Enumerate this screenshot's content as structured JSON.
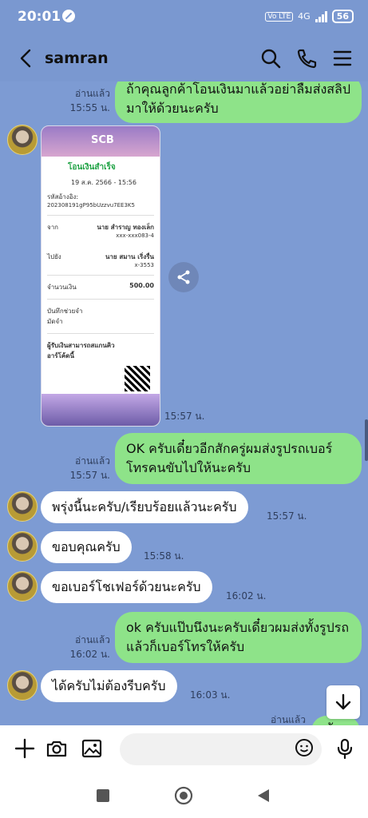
{
  "status": {
    "time": "20:01",
    "volte": "Vo LTE",
    "network": "4G",
    "battery": "56"
  },
  "header": {
    "title": "samran"
  },
  "messages": {
    "m0": {
      "text": "ถ้าคุณลูกค้าโอนเงินมาแล้วอย่าลืมส่งสลิปมาให้ด้วยนะครับ",
      "read": "อ่านแล้ว",
      "time": "15:55 น."
    },
    "slip": {
      "bank": "SCB",
      "status": "โอนเงินสำเร็จ",
      "date": "19 ส.ค. 2566 - 15:56",
      "ref_label": "รหัสอ้างอิง:",
      "ref": "202308191gP95bUzzvu7EE3K5",
      "from_label": "จาก",
      "from_name": "นาย สำราญ ทองเล็ก",
      "from_acct": "xxx-xxx083-4",
      "to_label": "ไปยัง",
      "to_name": "นาย สมาน เริ่งรื่น",
      "to_acct": "x-3553",
      "amount_label": "จำนวนเงิน",
      "amount": "500.00",
      "memo_label": "บันทึกช่วยจำ",
      "memo": "มัดจำ",
      "qr_label": "ผู้รับเงินสามารถสแกนคิวอาร์โค้ดนี้",
      "time": "15:57 น."
    },
    "m1": {
      "text": "OK ครับเดี๋ยวอีกสักครู่ผมส่งรูปรถเบอร์โทรคนขับไปให้นะครับ",
      "read": "อ่านแล้ว",
      "time": "15:57 น."
    },
    "m2": {
      "text": "พรุ่งนี้นะครับ/เรียบร้อยแล้วนะครับ",
      "time": "15:57 น."
    },
    "m3": {
      "text": "ขอบคุณครับ",
      "time": "15:58 น."
    },
    "m4": {
      "text": "ขอเบอร์โชเฟอร์ด้วยนะครับ",
      "time": "16:02 น."
    },
    "m5": {
      "text": "ok ครับแป๊บนึงนะครับเดี๋ยวผมส่งทั้งรูปรถแล้วก็เบอร์โทรให้ครับ",
      "read": "อ่านแล้ว",
      "time": "16:02 น."
    },
    "m6": {
      "text": "ได้ครับไม่ต้องรีบครับ",
      "time": "16:03 น."
    },
    "m7": {
      "text": "ครับ",
      "read": "อ่านแล้ว"
    }
  },
  "input": {
    "placeholder": ""
  },
  "colors": {
    "chat_bg": "#7d9bd3",
    "outgoing": "#8ee389",
    "incoming": "#ffffff"
  }
}
